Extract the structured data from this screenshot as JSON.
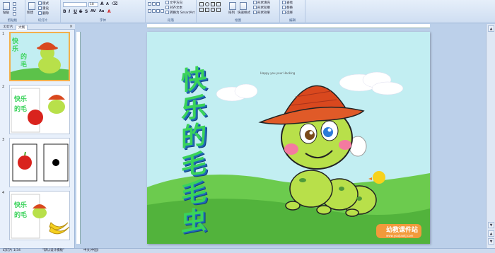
{
  "ribbon": {
    "groups": [
      {
        "label": "剪贴板"
      },
      {
        "label": "幻灯片"
      },
      {
        "label": "字体"
      },
      {
        "label": "段落"
      },
      {
        "label": "绘图"
      },
      {
        "label": "编辑"
      }
    ],
    "clipboard": {
      "paste": "粘贴"
    },
    "slides": {
      "new_slide": "新建\n幻灯片",
      "layout": "版式",
      "reset": "重设",
      "delete": "删除"
    },
    "font": {
      "size": "18"
    },
    "paragraph": {
      "text_direction": "文字方向",
      "align_text": "对齐文本",
      "smartart": "转换为 SmartArt"
    },
    "drawing": {
      "arrange": "排列",
      "quick_styles": "快速样式",
      "fill": "形状填充",
      "outline": "形状轮廓",
      "effects": "形状效果"
    },
    "editing": {
      "find": "查找",
      "replace": "替换",
      "select": "选择"
    }
  },
  "left_panel": {
    "tabs": [
      "幻灯片",
      "大纲"
    ],
    "close": "×",
    "slides": [
      {
        "number": "1"
      },
      {
        "number": "2"
      },
      {
        "number": "3"
      },
      {
        "number": "4"
      }
    ]
  },
  "slide": {
    "title_chars": [
      "快",
      "乐",
      "的",
      "毛",
      "毛",
      "虫"
    ],
    "caption": "Happy you your Hacking",
    "watermark": "幼教课件站",
    "watermark_url": "www.youjiaokj.com"
  },
  "status": {
    "slide": "幻灯片 1/34",
    "theme": "\"默认设计模板\"",
    "language": "中文(中国)"
  },
  "colors": {
    "title_green": "#3ad35a",
    "sky": "#c2eef2",
    "grass": "#5cc24a",
    "hat": "#d9481e",
    "worm": "#b8e04a"
  }
}
